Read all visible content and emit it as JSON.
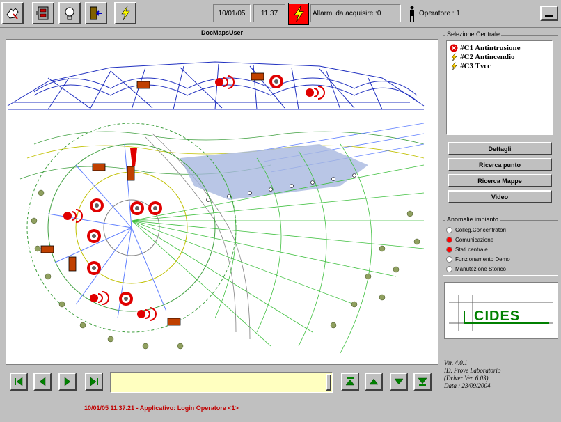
{
  "toolbar": {
    "buttons": [
      {
        "icon": "hand-pointer-icon"
      },
      {
        "icon": "cabinet-icon"
      },
      {
        "icon": "lightbulb-icon"
      },
      {
        "icon": "exit-door-icon"
      },
      {
        "icon": "lightning-icon"
      }
    ],
    "date": "10/01/05",
    "time": "11.37",
    "alarm_text": "Allarmi da acquisire :0",
    "operator_text": "Operatore : 1",
    "alarm_color": "#ff0000",
    "lightning_color": "#ffff00"
  },
  "map": {
    "title": "DocMapsUser"
  },
  "selezione": {
    "label": "Selezione Centrale",
    "items": [
      {
        "label": "#C1 Antintrusione",
        "icon": "error-cross-icon"
      },
      {
        "label": "#C2 Antincendio",
        "icon": "lightning-icon"
      },
      {
        "label": "#C3 Tvcc",
        "icon": "lightning-icon"
      }
    ]
  },
  "actions": {
    "dettagli": "Dettagli",
    "ricerca_punto": "Ricerca punto",
    "ricerca_mappe": "Ricerca Mappe",
    "video": "Video"
  },
  "anomalie": {
    "label": "Anomalie impianto",
    "items": [
      {
        "label": "Colleg.Concentratori",
        "color": "#ffffff"
      },
      {
        "label": "Comunicazione",
        "color": "#ff0000"
      },
      {
        "label": "Stati centrale",
        "color": "#ff0000"
      },
      {
        "label": "Funzionamento Demo",
        "color": "#ffffff"
      },
      {
        "label": "Manutezione Storico",
        "color": "#ffffff"
      }
    ]
  },
  "logo": {
    "text": "CIDES",
    "color": "#008000"
  },
  "version": {
    "line1": "Ver. 4.0.1",
    "line2": "ID. Prove Laboratorio",
    "line3": "(Driver Ver. 6.03)",
    "line4": "Data : 23/09/2004"
  },
  "navigation": {
    "first": "first-page-icon",
    "prev": "previous-icon",
    "next": "next-icon",
    "last": "last-page-icon",
    "up_fast": "fast-up-icon",
    "up": "up-icon",
    "down": "down-icon",
    "down_fast": "fast-down-icon",
    "nav_color": "#008000"
  },
  "status": {
    "text": "10/01/05 11.37.21 - Applicativo:  Login Operatore <1>"
  }
}
